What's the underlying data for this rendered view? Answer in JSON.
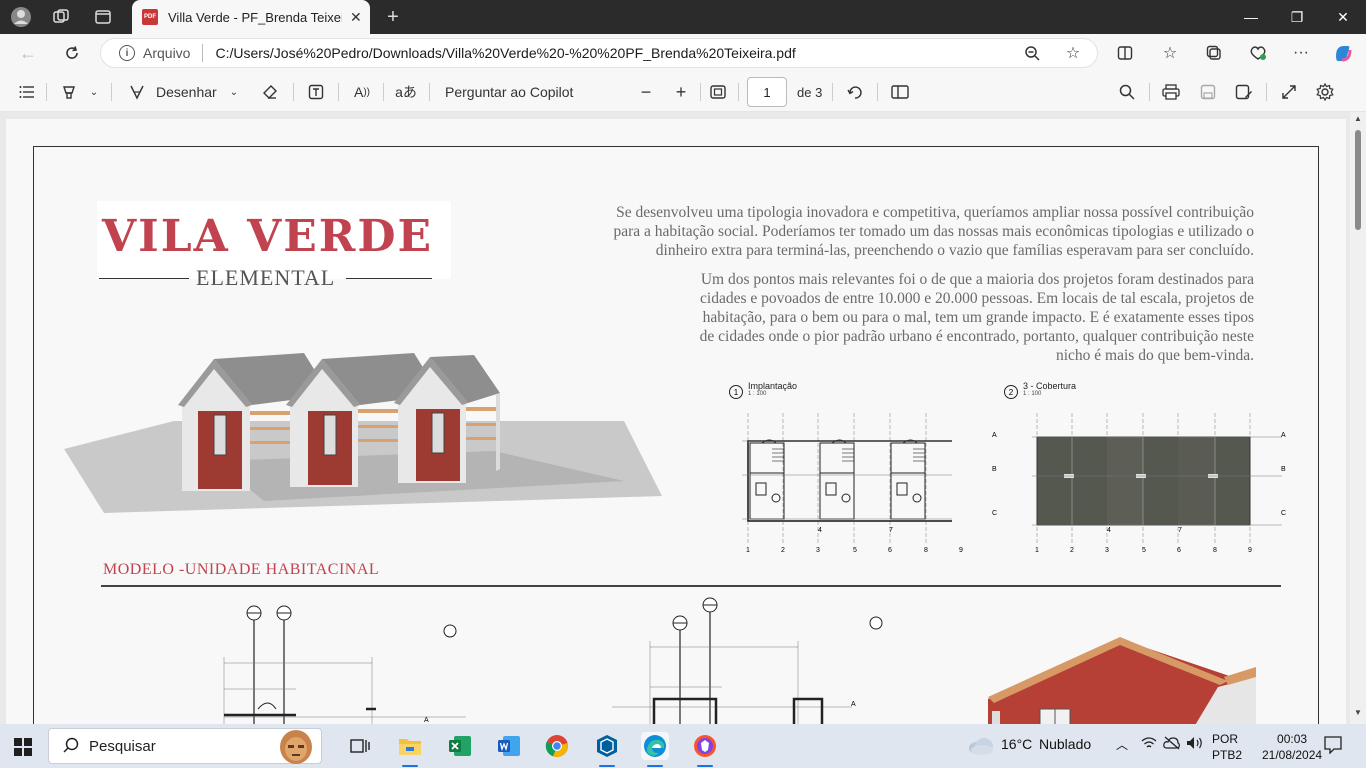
{
  "browser": {
    "tab": {
      "title": "Villa Verde - PF_Brenda Teixeira.p",
      "icon": "pdf-icon"
    },
    "new_tab": "+",
    "window": {
      "minimize": "—",
      "restore": "❐",
      "close": "✕"
    },
    "address": {
      "scheme_label": "Arquivo",
      "url": "C:/Users/José%20Pedro/Downloads/Villa%20Verde%20-%20%20PF_Brenda%20Teixeira.pdf"
    }
  },
  "pdf_toolbar": {
    "draw_label": "Desenhar",
    "copilot_label": "Perguntar ao Copilot",
    "zoom_out": "−",
    "zoom_in": "+",
    "page_current": "1",
    "page_total": "de 3"
  },
  "document": {
    "title": "VILA VERDE",
    "subtitle": "ELEMENTAL",
    "paragraph1": [
      "Se desenvolveu uma tipologia inovadora e competitiva, queríamos ampliar nossa possível contribuição",
      "para a habitação social. Poderíamos ter tomado um das nossas mais econômicas tipologias e utilizado o",
      "dinheiro extra para terminá-las, preenchendo o vazio que famílias esperavam para ser concluído."
    ],
    "paragraph2": [
      "Um dos pontos mais relevantes foi o de que a maioria dos projetos foram destinados para",
      "cidades e povoados de entre 10.000 e 20.000 pessoas. Em locais de tal escala, projetos de",
      "habitação, para o bem ou para o mal, tem um grande impacto. E é exatamente esses tipos",
      "de cidades onde o pior padrão urbano é encontrado, portanto, qualquer contribuição neste",
      "nicho é mais do que bem-vinda."
    ],
    "plan1": {
      "num": "1",
      "label": "Implantação",
      "scale": "1 : 100"
    },
    "plan2": {
      "num": "2",
      "label": "3 - Cobertura",
      "scale": "1 : 100"
    },
    "grid_rows": [
      "A",
      "B",
      "C"
    ],
    "grid_cols": [
      "1",
      "2",
      "3",
      "5",
      "6",
      "8",
      "9"
    ],
    "grid_mid": [
      "4",
      "7"
    ],
    "section_title": "MODELO -UNIDADE HABITACINAL",
    "axis_a": "A"
  },
  "taskbar": {
    "search_placeholder": "Pesquisar",
    "weather_temp": "16°C",
    "weather_text": "Nublado",
    "lang_line1": "POR",
    "lang_line2": "PTB2",
    "time": "00:03",
    "date": "21/08/2024",
    "apps": [
      "file-explorer",
      "excel",
      "word",
      "chrome",
      "sketchup",
      "edge",
      "brave"
    ]
  },
  "colors": {
    "accent": "#c0434f",
    "chrome_dark": "#2b2b2b",
    "roof_dark": "#55584f"
  }
}
